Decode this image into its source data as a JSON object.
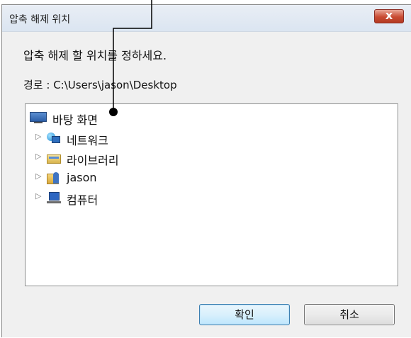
{
  "window": {
    "title": "압축 해제 위치",
    "close_label": "x"
  },
  "prompt": "압축 해제 할 위치를 정하세요.",
  "path_label": "경로 : C:\\Users\\jason\\Desktop",
  "tree": {
    "root": {
      "label": "바탕 화면",
      "icon": "desktop-icon"
    },
    "children": [
      {
        "label": "네트워크",
        "icon": "network-icon",
        "expander": "▷"
      },
      {
        "label": "라이브러리",
        "icon": "library-icon",
        "expander": "▷"
      },
      {
        "label": "jason",
        "icon": "user-folder-icon",
        "expander": "▷"
      },
      {
        "label": "컴퓨터",
        "icon": "computer-icon",
        "expander": "▷"
      }
    ]
  },
  "buttons": {
    "ok_label": "확인",
    "cancel_label": "취소"
  },
  "colors": {
    "ok_border": "#3c7fb1",
    "close_red": "#c94b33",
    "callout": "#000000"
  }
}
